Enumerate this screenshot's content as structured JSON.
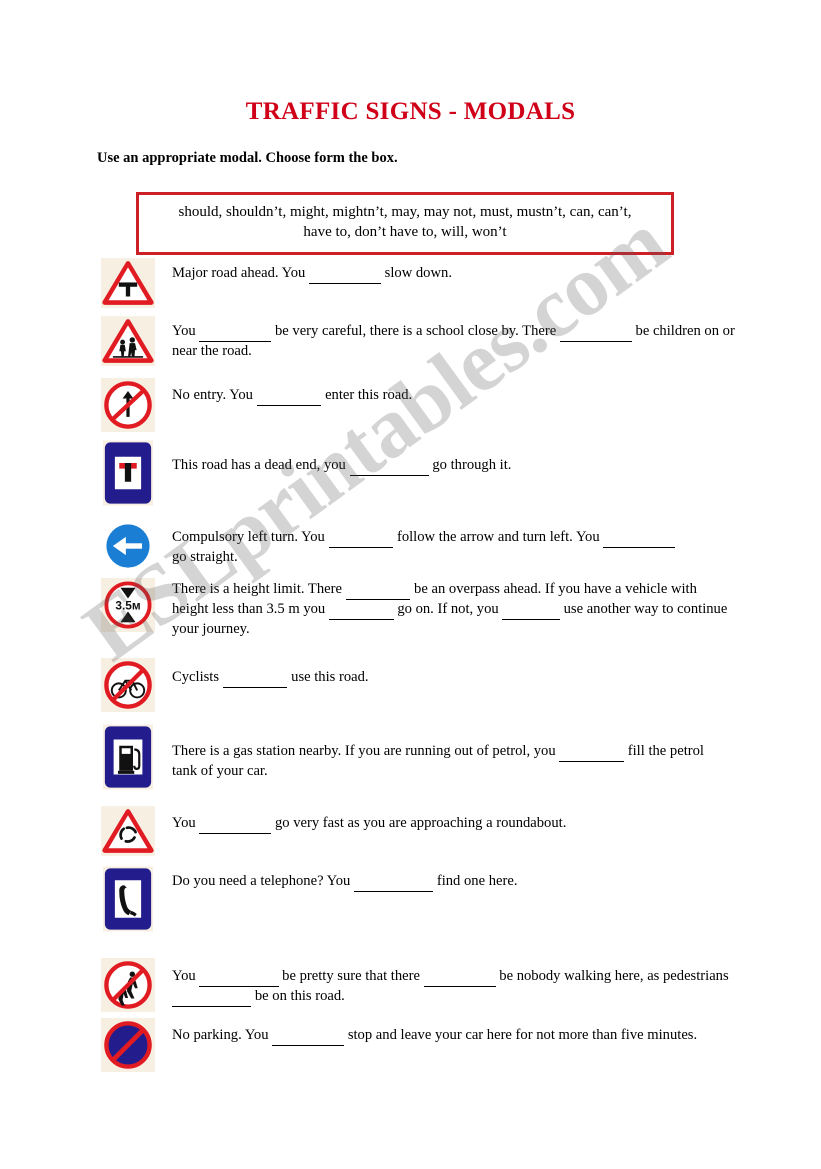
{
  "document": {
    "title": "TRAFFIC SIGNS - MODALS",
    "title_color": "#d00018",
    "instruction": "Use an appropriate modal. Choose form the box.",
    "watermark": "ESLprintables.com",
    "box_border_color": "#cc2026"
  },
  "modal_box": {
    "line1": "should, shouldn’t, might, mightn’t, may, may not, must, mustn’t, can, can’t,",
    "line2": "have to, don’t have to, will, won’t"
  },
  "items": [
    {
      "sign": "major-road-ahead-sign",
      "seg1": "Major road ahead.   You",
      "blank1": "__________",
      "seg2": "slow down."
    },
    {
      "sign": "school-children-crossing-sign",
      "seg1": "You",
      "blank1": "__________",
      "seg2": "be very careful, there is a school close by. There",
      "blank2": "__________",
      "seg3": "be children on or near the road."
    },
    {
      "sign": "no-entry-sign",
      "seg1": "No entry. You",
      "blank1": "_________",
      "seg2": "enter this road."
    },
    {
      "sign": "dead-end-road-sign",
      "seg1": "This road has a dead end, you",
      "blank1": "___________",
      "seg2": "go through it."
    },
    {
      "sign": "compulsory-left-turn-sign",
      "seg1": "Compulsory left turn. You",
      "blank1": "_________",
      "seg2": "follow the arrow and turn left. You",
      "blank2": "__________",
      "seg3": "go straight."
    },
    {
      "sign": "height-limit-sign",
      "seg1": "There is a height limit. There",
      "blank1": "_________",
      "seg2": "be an overpass ahead. If you have a vehicle with height less than 3.5 m you",
      "blank2": "_________",
      "seg3": "go on. If not, you",
      "blank3": "________",
      "seg4": "use another way to continue your journey."
    },
    {
      "sign": "no-bicycles-sign",
      "seg1": "Cyclists",
      "blank1": "_________",
      "seg2": "use this road."
    },
    {
      "sign": "gas-station-sign",
      "seg1": "There is a gas station nearby. If you are running out of petrol, you",
      "blank1": "_________",
      "seg2": "fill the petrol tank of your car."
    },
    {
      "sign": "roundabout-ahead-sign",
      "seg1": "You",
      "blank1": "__________",
      "seg2": "go very fast as you are approaching a roundabout."
    },
    {
      "sign": "telephone-sign",
      "seg1": "Do you need a telephone? You",
      "blank1": "___________",
      "seg2": "find one here."
    },
    {
      "sign": "no-pedestrians-sign",
      "seg1": "You",
      "blank1": "___________",
      "seg2": "be pretty sure that there",
      "blank2": "__________",
      "seg3": "be nobody walking here, as pedestrians",
      "blank3": "___________",
      "seg4": "be on this road."
    },
    {
      "sign": "no-parking-sign",
      "seg1": "No parking.  You",
      "blank1": "__________",
      "seg2": "stop and leave your car here for not more than five minutes."
    }
  ],
  "sign_labels": {
    "height_limit_text": "3.5м"
  },
  "colors": {
    "sign_red": "#e01b22",
    "sign_blue": "#1b3fa0",
    "sign_dark_blue": "#221c8c",
    "sign_light_blue": "#1a7fd4",
    "sign_bg_beige": "#f7efe2",
    "black": "#111111"
  }
}
